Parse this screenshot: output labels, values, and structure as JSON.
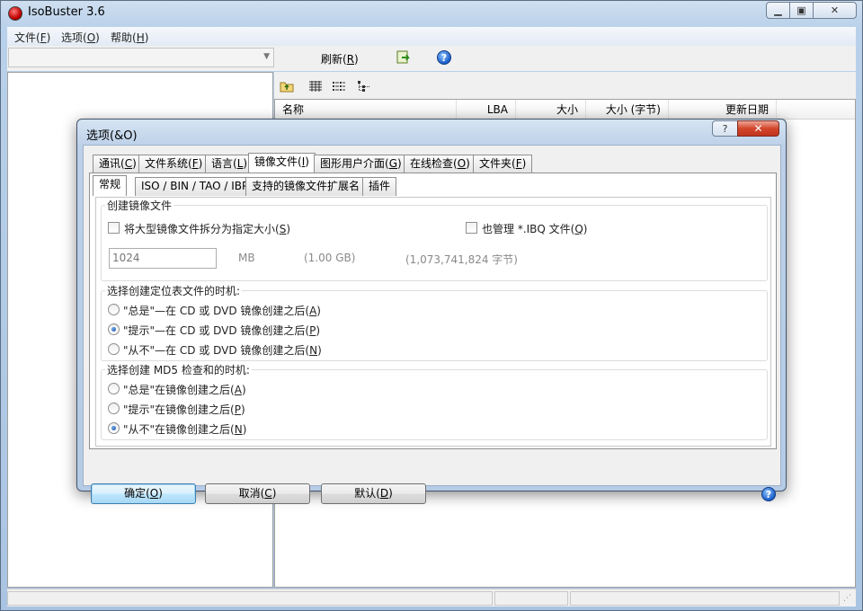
{
  "window": {
    "title": "IsoBuster 3.6"
  },
  "menu": [
    {
      "text": "文件(",
      "key": "F",
      "tail": ")"
    },
    {
      "text": "选项(",
      "key": "O",
      "tail": ")"
    },
    {
      "text": "帮助(",
      "key": "H",
      "tail": ")"
    }
  ],
  "toolbar": {
    "refresh_text": "刷新(",
    "refresh_key": "R",
    "refresh_tail": ")"
  },
  "list_columns": [
    "名称",
    "LBA",
    "大小",
    "大小 (字节)",
    "更新日期"
  ],
  "dialog": {
    "title": "选项(&O)",
    "tabs": [
      {
        "text": "通讯(",
        "key": "C",
        "tail": ")"
      },
      {
        "text": "文件系统(",
        "key": "F",
        "tail": ")"
      },
      {
        "text": "语言(",
        "key": "L",
        "tail": ")"
      },
      {
        "text": "镜像文件(",
        "key": "I",
        "tail": ")"
      },
      {
        "text": "图形用户介面(",
        "key": "G",
        "tail": ")"
      },
      {
        "text": "在线检查(",
        "key": "O",
        "tail": ")"
      },
      {
        "text": "文件夹(",
        "key": "F",
        "tail": ")"
      }
    ],
    "subtabs": [
      "常规",
      "ISO / BIN / TAO / IBP",
      "支持的镜像文件扩展名",
      "插件"
    ],
    "create_group": {
      "title": "创建镜像文件",
      "split_text": "将大型镜像文件拆分为指定大小(",
      "split_key": "S",
      "split_tail": ")",
      "ibq_text": "也管理 *.IBQ 文件(",
      "ibq_key": "Q",
      "ibq_tail": ")",
      "size_value": "1024",
      "unit": "MB",
      "gb": "(1.00 GB)",
      "bytes": "(1,073,741,824 字节)"
    },
    "cue_group": {
      "title": "选择创建定位表文件的时机:",
      "options": [
        {
          "text": "\"总是\"—在 CD 或 DVD 镜像创建之后(",
          "key": "A",
          "tail": ")",
          "checked": false
        },
        {
          "text": "\"提示\"—在 CD 或 DVD 镜像创建之后(",
          "key": "P",
          "tail": ")",
          "checked": true
        },
        {
          "text": "\"从不\"—在 CD 或 DVD 镜像创建之后(",
          "key": "N",
          "tail": ")",
          "checked": false
        }
      ]
    },
    "md5_group": {
      "title": "选择创建 MD5 检查和的时机:",
      "options": [
        {
          "text": "\"总是\"在镜像创建之后(",
          "key": "A",
          "tail": ")",
          "checked": false
        },
        {
          "text": "\"提示\"在镜像创建之后(",
          "key": "P",
          "tail": ")",
          "checked": false
        },
        {
          "text": "\"从不\"在镜像创建之后(",
          "key": "N",
          "tail": ")",
          "checked": true
        }
      ]
    },
    "buttons": {
      "ok_text": "确定(",
      "ok_key": "O",
      "ok_tail": ")",
      "cancel_text": "取消(",
      "cancel_key": "C",
      "cancel_tail": ")",
      "default_text": "默认(",
      "default_key": "D",
      "default_tail": ")"
    }
  }
}
